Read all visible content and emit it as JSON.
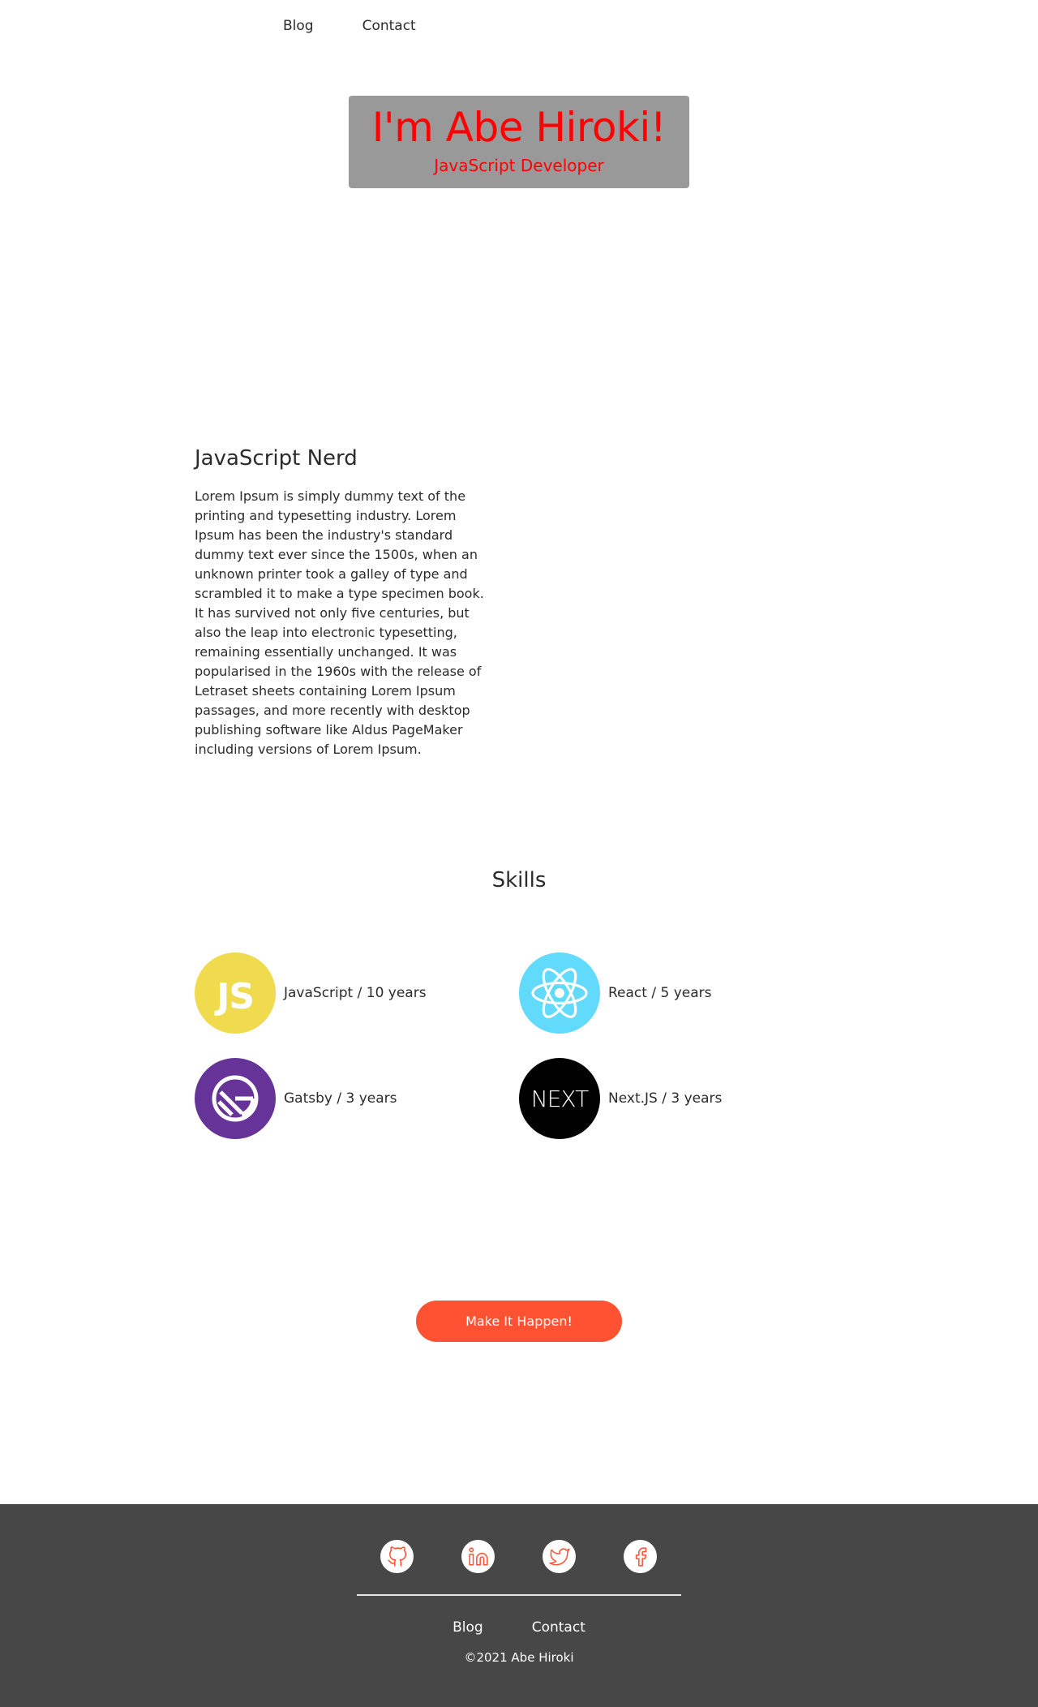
{
  "nav": {
    "items": [
      "Blog",
      "Contact"
    ]
  },
  "hero": {
    "name": "I'm Abe Hiroki!",
    "role": "JavaScript Developer"
  },
  "about": {
    "title": "JavaScript Nerd",
    "body": "Lorem Ipsum is simply dummy text of the printing and typesetting industry. Lorem Ipsum has been the industry's standard dummy text ever since the 1500s, when an unknown printer took a galley of type and scrambled it to make a type specimen book. It has survived not only five centuries, but also the leap into electronic typesetting, remaining essentially unchanged. It was popularised in the 1960s with the release of Letraset sheets containing Lorem Ipsum passages, and more recently with desktop publishing software like Aldus PageMaker including versions of Lorem Ipsum."
  },
  "skills": {
    "title": "Skills",
    "items": [
      {
        "label": "JavaScript / 10 years",
        "icon": "javascript-logo-icon",
        "logo_text": "JS",
        "color": "#f0db4f"
      },
      {
        "label": "React / 5 years",
        "icon": "react-logo-icon",
        "color": "#61dafb"
      },
      {
        "label": "Gatsby / 3 years",
        "icon": "gatsby-logo-icon",
        "color": "#663399"
      },
      {
        "label": "Next.JS / 3 years",
        "icon": "nextjs-logo-icon",
        "logo_text": "NEXT",
        "color": "#000000"
      }
    ]
  },
  "cta": {
    "label": "Make It Happen!",
    "color": "#ff5233"
  },
  "footer": {
    "social": [
      "github-icon",
      "linkedin-icon",
      "twitter-icon",
      "facebook-icon"
    ],
    "accent": "#ff5233",
    "nav": [
      "Blog",
      "Contact"
    ],
    "copyright": "©2021 Abe Hiroki",
    "background": "#474747"
  }
}
